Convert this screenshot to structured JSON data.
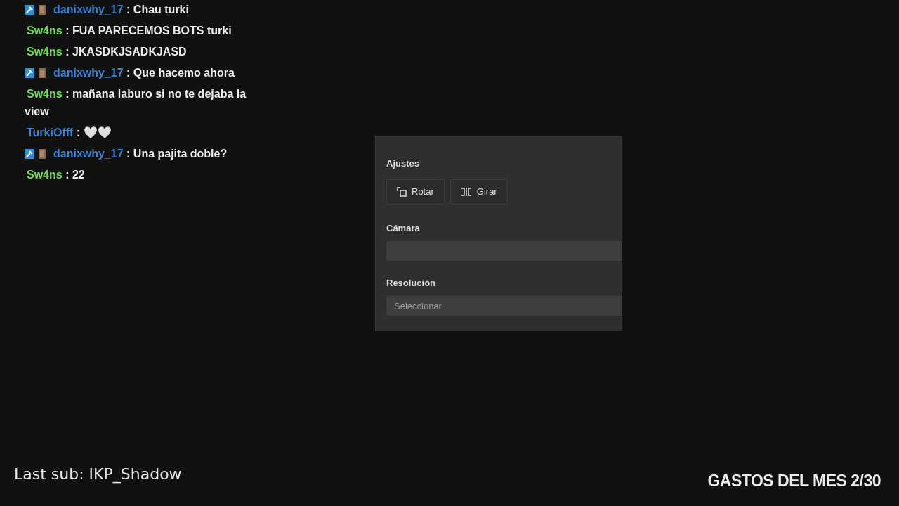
{
  "chat": [
    {
      "user": "danixwhy_17",
      "color": "#3b82d6",
      "badged": true,
      "text": ": Chau turki"
    },
    {
      "user": "Sw4ns",
      "color": "#6ee05a",
      "badged": false,
      "text": ": FUA PARECEMOS BOTS turki"
    },
    {
      "user": "Sw4ns",
      "color": "#6ee05a",
      "badged": false,
      "text": ": JKASDKJSADKJASD"
    },
    {
      "user": "danixwhy_17",
      "color": "#3b82d6",
      "badged": true,
      "text": ": Que hacemo ahora"
    },
    {
      "user": "Sw4ns",
      "color": "#6ee05a",
      "badged": false,
      "text": ": mañana laburo si no te dejaba la view"
    },
    {
      "user": "TurkiOfff",
      "color": "#3b82d6",
      "badged": false,
      "text": ": 🤍🤍"
    },
    {
      "user": "danixwhy_17",
      "color": "#3b82d6",
      "badged": true,
      "text": ": Una pajita doble?"
    },
    {
      "user": "Sw4ns",
      "color": "#6ee05a",
      "badged": false,
      "text": ": 22"
    }
  ],
  "panel": {
    "section": "Ajustes",
    "buttons": [
      {
        "kind": "rotate",
        "label": "Rotar"
      },
      {
        "kind": "flip",
        "label": "Girar"
      }
    ],
    "fields": [
      {
        "label": "Cámara"
      },
      {
        "label": "Resolución",
        "placeholder": "Seleccionar"
      }
    ]
  },
  "last_sub": "Last sub: IKP_Shadow",
  "goal": "GASTOS DEL MES 2/30"
}
